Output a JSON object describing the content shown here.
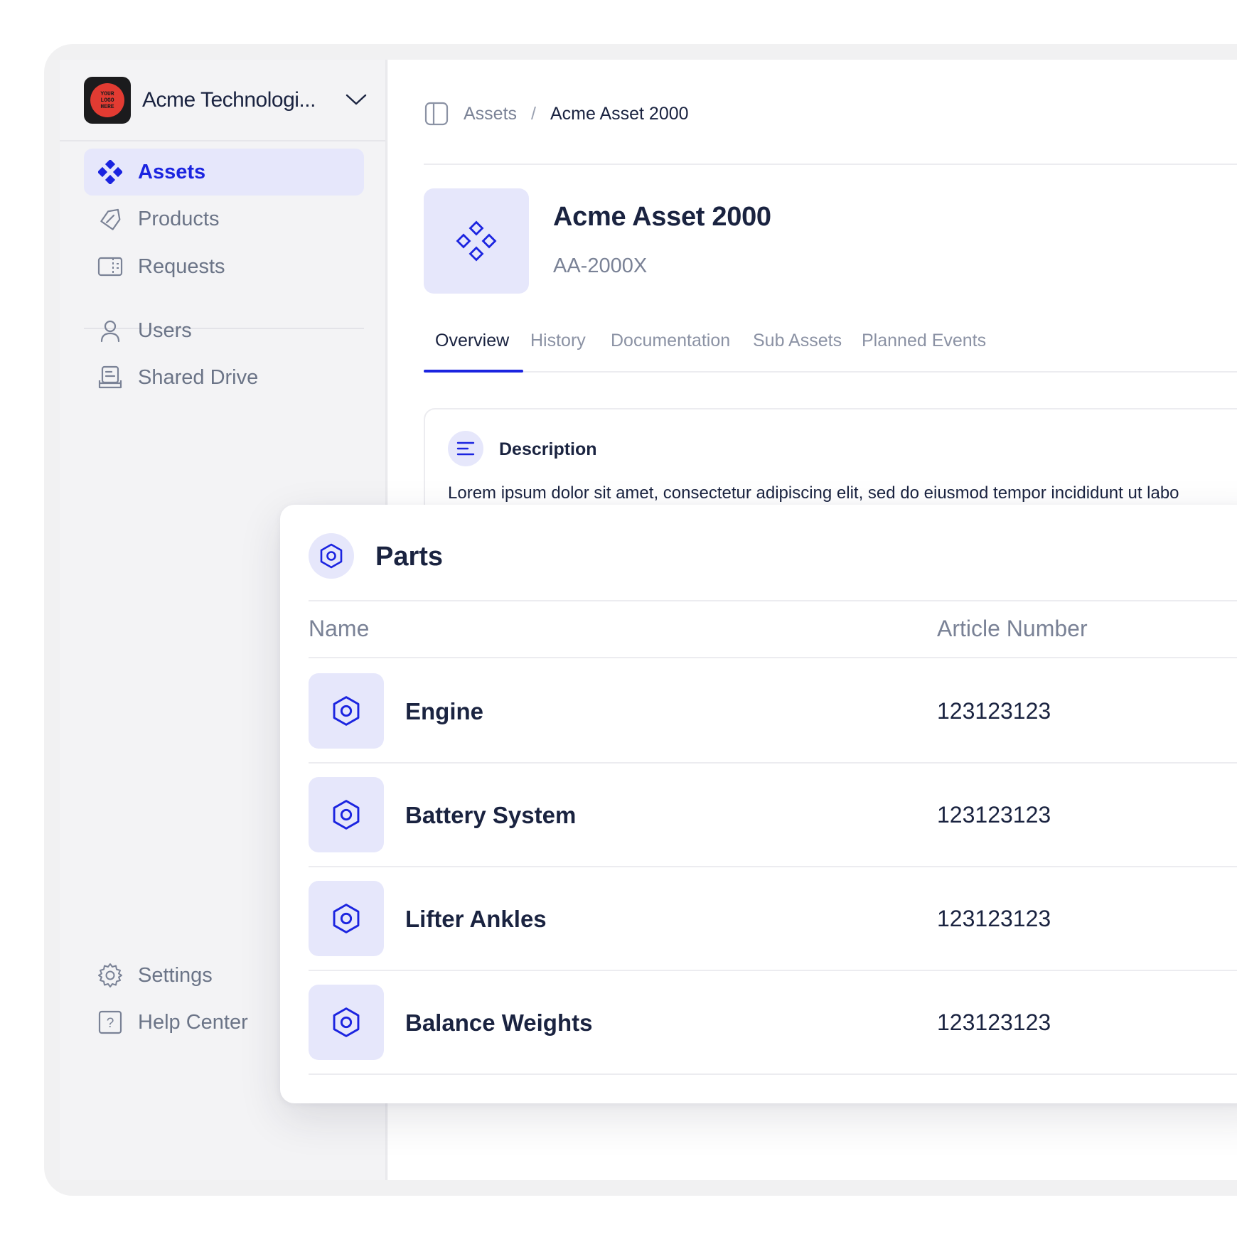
{
  "org": {
    "name": "Acme Technologi...",
    "logo_text": "YOUR LOGO HERE"
  },
  "sidebar": {
    "items": [
      {
        "label": "Assets",
        "icon": "assets-icon"
      },
      {
        "label": "Products",
        "icon": "tag-icon"
      },
      {
        "label": "Requests",
        "icon": "book-icon"
      },
      {
        "label": "Users",
        "icon": "user-icon"
      },
      {
        "label": "Shared Drive",
        "icon": "drive-icon"
      }
    ],
    "footer": [
      {
        "label": "Settings",
        "icon": "gear-icon"
      },
      {
        "label": "Help Center",
        "icon": "help-icon"
      }
    ]
  },
  "breadcrumb": {
    "parent": "Assets",
    "separator": "/",
    "current": "Acme Asset 2000"
  },
  "asset": {
    "title": "Acme Asset 2000",
    "code": "AA-2000X"
  },
  "tabs": [
    "Overview",
    "History",
    "Documentation",
    "Sub Assets",
    "Planned Events"
  ],
  "description": {
    "title": "Description",
    "text": "Lorem ipsum dolor sit amet, consectetur adipiscing elit, sed do eiusmod tempor incididunt ut labo"
  },
  "parts": {
    "title": "Parts",
    "columns": [
      "Name",
      "Article Number"
    ],
    "rows": [
      {
        "name": "Engine",
        "article": "123123123"
      },
      {
        "name": "Battery System",
        "article": "123123123"
      },
      {
        "name": "Lifter Ankles",
        "article": "123123123"
      },
      {
        "name": "Balance Weights",
        "article": "123123123"
      }
    ]
  },
  "colors": {
    "accent": "#1b24e0",
    "accent_soft": "#e6e7fb",
    "text": "#1a2340",
    "muted": "#7a8296"
  }
}
